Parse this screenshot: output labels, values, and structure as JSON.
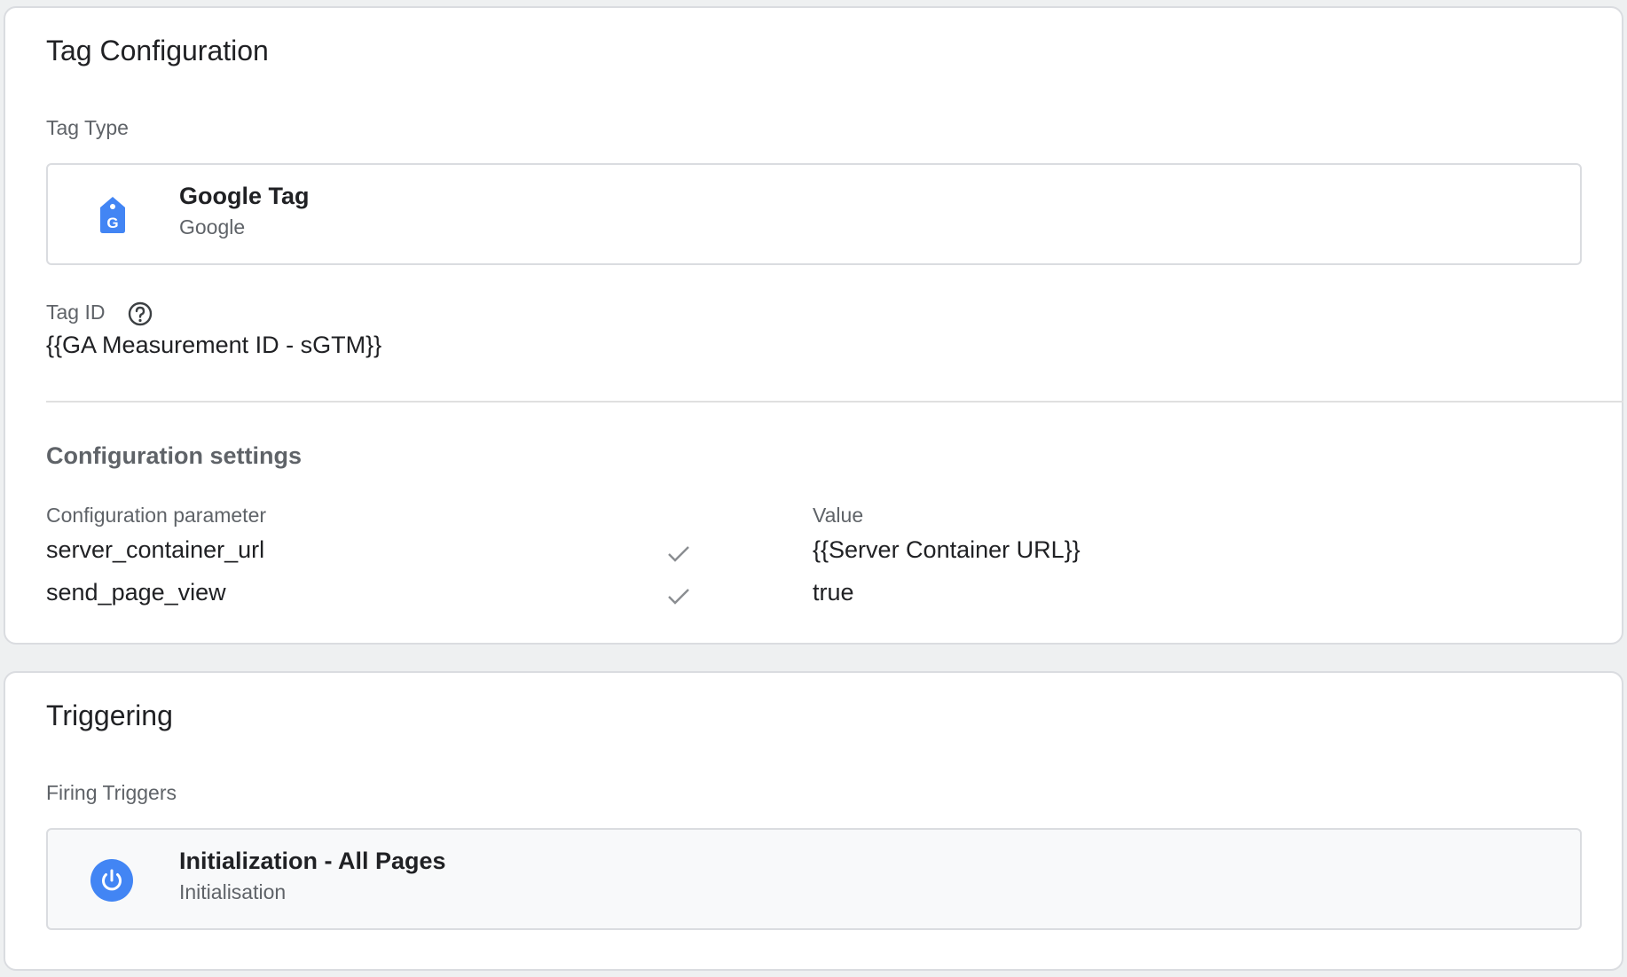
{
  "tag_configuration": {
    "title": "Tag Configuration",
    "tag_type_label": "Tag Type",
    "tag_type": {
      "name": "Google Tag",
      "vendor": "Google",
      "icon": "google-tag-icon",
      "icon_color": "#4285f4"
    },
    "tag_id_label": "Tag ID",
    "help_icon": "help-circle-icon",
    "tag_id_value": "{{GA Measurement ID - sGTM}}",
    "configuration_settings": {
      "heading": "Configuration settings",
      "param_header": "Configuration parameter",
      "value_header": "Value",
      "rows": [
        {
          "parameter": "server_container_url",
          "checked": true,
          "value": "{{Server Container URL}}"
        },
        {
          "parameter": "send_page_view",
          "checked": true,
          "value": "true"
        }
      ]
    }
  },
  "triggering": {
    "title": "Triggering",
    "firing_triggers_label": "Firing Triggers",
    "trigger": {
      "name": "Initialization - All Pages",
      "type": "Initialisation",
      "icon": "power-icon",
      "icon_color": "#4285f4"
    }
  }
}
